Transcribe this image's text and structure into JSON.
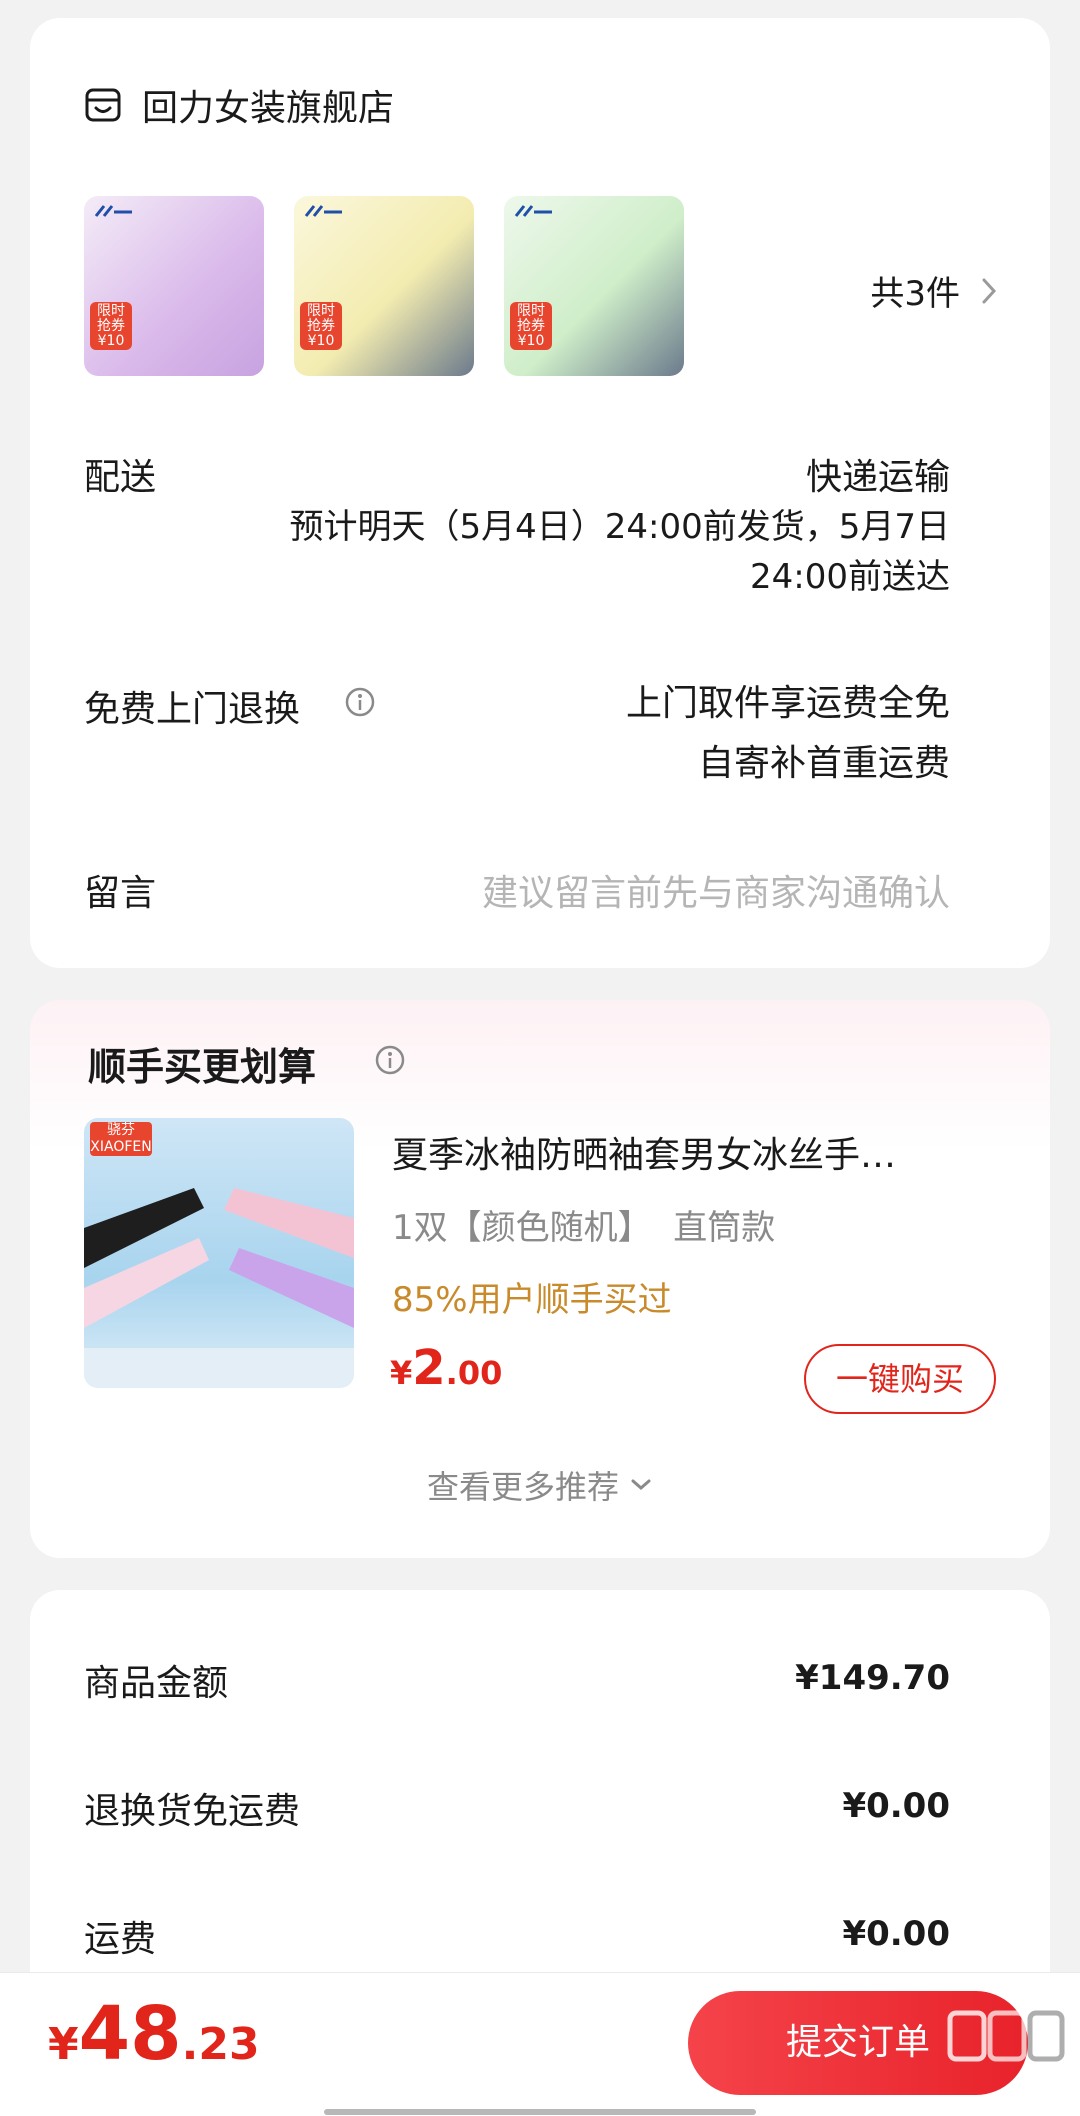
{
  "store": {
    "name": "回力女装旗舰店",
    "product_count": "共3件",
    "thumbnails": [
      {
        "tag": "限时\n抢券\n¥10",
        "colors": [
          "#d9b8ea",
          "#c7a3e0"
        ]
      },
      {
        "tag": "限时\n抢券\n¥10",
        "colors": [
          "#f3ecb0",
          "#e6d77e"
        ]
      },
      {
        "tag": "限时\n抢券\n¥10",
        "colors": [
          "#cfeec9",
          "#a9dca5"
        ]
      }
    ]
  },
  "delivery": {
    "label": "配送",
    "method": "快递运输",
    "estimate_line1": "预计明天（5月4日）24:00前发货，5月7日",
    "estimate_line2": "24:00前送达"
  },
  "returns": {
    "label": "免费上门退换",
    "line1": "上门取件享运费全免",
    "line2": "自寄补首重运费"
  },
  "message": {
    "label": "留言",
    "placeholder": "建议留言前先与商家沟通确认"
  },
  "recommend": {
    "title": "顺手买更划算",
    "item": {
      "brand": "骁芬\nXIAOFEN",
      "name": "夏季冰袖防晒袖套男女冰丝手…",
      "spec": "1双【颜色随机】  直筒款",
      "popularity": "85%用户顺手买过",
      "price_symbol": "¥",
      "price_int": "2",
      "price_dec": ".00",
      "buy_label": "一键购买"
    },
    "more_label": "查看更多推荐"
  },
  "costs": [
    {
      "label": "商品金额",
      "value": "¥149.70"
    },
    {
      "label": "退换货免运费",
      "value": "¥0.00"
    },
    {
      "label": "运费",
      "value": "¥0.00"
    }
  ],
  "footer": {
    "total_symbol": "¥",
    "total_int": "48",
    "total_dec": ".23",
    "submit_label": "提交订单"
  },
  "colors": {
    "accent": "#e1251b",
    "muted": "#b5b5b5",
    "gold": "#c88a2a"
  }
}
